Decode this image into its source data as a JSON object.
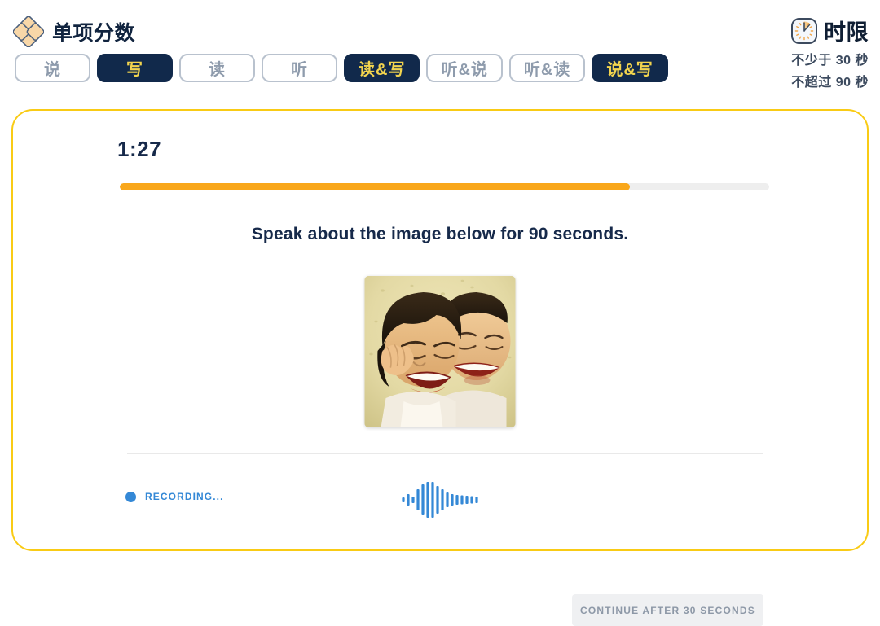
{
  "header": {
    "logo_icon": "diamond-cluster-logo",
    "title": "单项分数",
    "tabs": [
      {
        "label": "说",
        "active": false
      },
      {
        "label": "写",
        "active": true
      },
      {
        "label": "读",
        "active": false
      },
      {
        "label": "听",
        "active": false
      },
      {
        "label": "读&写",
        "active": true
      },
      {
        "label": "听&说",
        "active": false
      },
      {
        "label": "听&读",
        "active": false
      },
      {
        "label": "说&写",
        "active": true
      }
    ],
    "time_limit": {
      "icon": "clock-icon",
      "title": "时限",
      "min_line": "不少于 30 秒",
      "max_line": "不超过 90 秒"
    }
  },
  "card": {
    "timer": "1:27",
    "progress": {
      "percent": 78.6,
      "fill_color": "#f9a71b",
      "track_color": "#eeeeee"
    },
    "prompt": "Speak about the image below for 90 seconds.",
    "image": {
      "alt": "two laughing children",
      "caption": ""
    },
    "footer": {
      "recording_label": "RECORDING...",
      "recording_color": "#3488d6",
      "waveform_icon": "audio-waveform-icon",
      "waveform_bars": [
        6,
        14,
        8,
        26,
        38,
        44,
        44,
        34,
        26,
        18,
        14,
        12,
        11,
        10,
        9,
        8
      ],
      "continue_label": "CONTINUE AFTER 30 SECONDS",
      "continue_disabled": true
    }
  },
  "colors": {
    "navy": "#11294b",
    "yellow": "#f2d44e",
    "card_border": "#f9cb15",
    "orange": "#f9a71b",
    "blue": "#3488d6",
    "gray_border": "#b9c2ce"
  }
}
